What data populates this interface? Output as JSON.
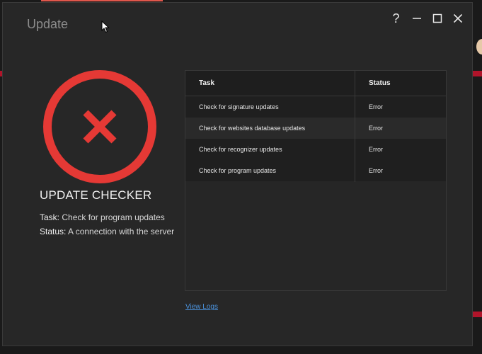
{
  "window": {
    "title": "Update",
    "controls": [
      {
        "name": "help-icon",
        "glyph": "?"
      },
      {
        "name": "minimize-icon",
        "glyph": "—"
      },
      {
        "name": "maximize-icon",
        "glyph": "□"
      },
      {
        "name": "close-icon",
        "glyph": "✕"
      }
    ]
  },
  "status": {
    "icon": "error-x-circle-icon",
    "icon_color": "#e53935",
    "heading": "UPDATE CHECKER",
    "task_label": "Task:",
    "task_value": "Check for program updates",
    "status_label": "Status:",
    "status_value": "A connection with the server ..."
  },
  "table": {
    "columns": [
      "Task",
      "Status"
    ],
    "rows": [
      {
        "task": "Check for signature updates",
        "status": "Error"
      },
      {
        "task": "Check for websites database updates",
        "status": "Error"
      },
      {
        "task": "Check for recognizer updates",
        "status": "Error"
      },
      {
        "task": "Check for program updates",
        "status": "Error"
      }
    ]
  },
  "links": {
    "view_logs": "View Logs"
  },
  "colors": {
    "window_bg": "#272727",
    "accent_error": "#e53935",
    "link": "#4a90d9"
  }
}
